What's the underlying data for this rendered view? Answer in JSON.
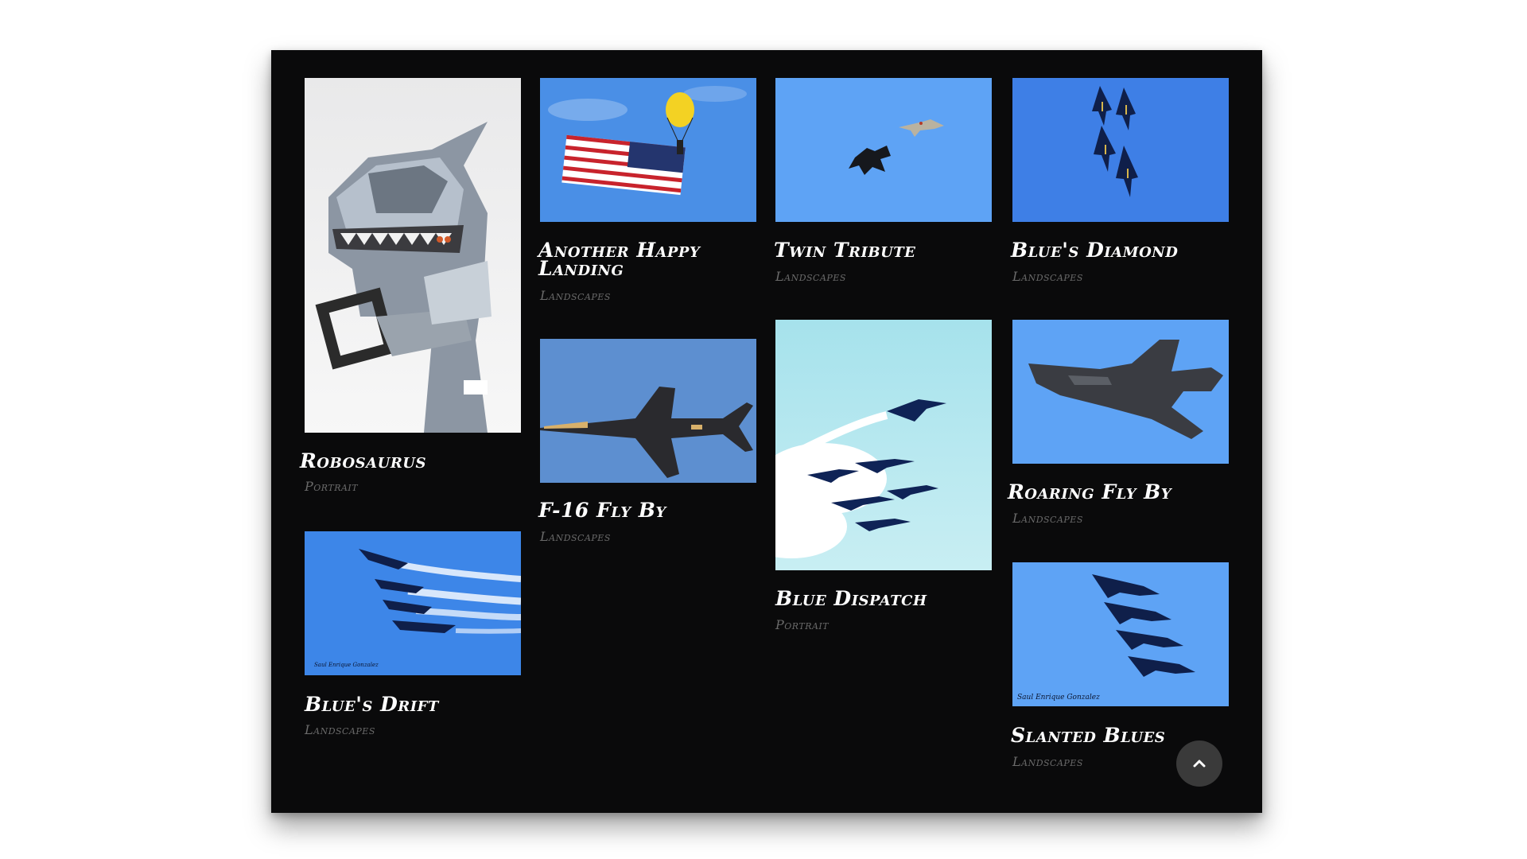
{
  "gallery": {
    "items": [
      {
        "title": "Robosaurus",
        "category": "Portrait"
      },
      {
        "title": "Another Happy Landing",
        "category": "Landscapes"
      },
      {
        "title": "Twin Tribute",
        "category": "Landscapes"
      },
      {
        "title": "Blue's Diamond",
        "category": "Landscapes"
      },
      {
        "title": "F-16 Fly By",
        "category": "Landscapes"
      },
      {
        "title": "Blue Dispatch",
        "category": "Portrait"
      },
      {
        "title": "Roaring Fly By",
        "category": "Landscapes"
      },
      {
        "title": "Blue's Drift",
        "category": "Landscapes"
      },
      {
        "title": "Slanted Blues",
        "category": "Landscapes"
      }
    ],
    "watermarks": [
      "Saul Enrique Gonzalez",
      "Saul Enrique Gonzalez"
    ]
  },
  "back_to_top": {
    "icon": "chevron-up-icon"
  },
  "colors": {
    "frame_bg": "#0a0a0b",
    "sky_blue": "#5b9ef2",
    "title": "#ffffff",
    "category": "#6a6a6a"
  }
}
